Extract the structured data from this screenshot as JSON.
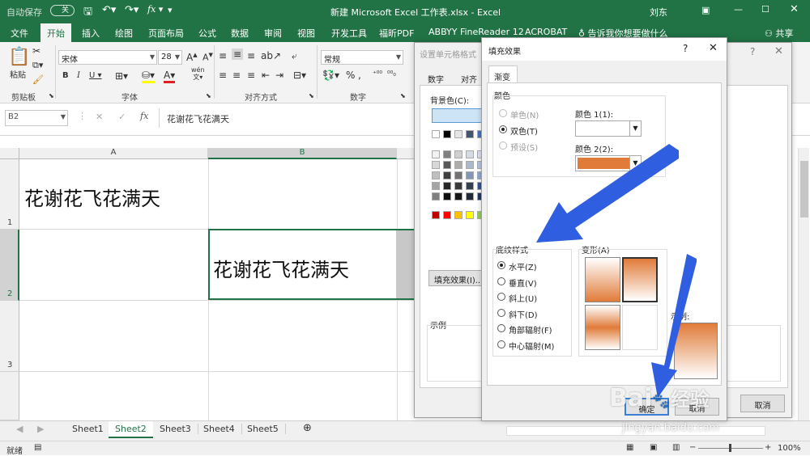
{
  "titlebar": {
    "autosave": "自动保存",
    "autosave_state": "关",
    "title": "新建 Microsoft Excel 工作表.xlsx  -  Excel",
    "user": "刘东"
  },
  "tabs": [
    "文件",
    "开始",
    "插入",
    "绘图",
    "页面布局",
    "公式",
    "数据",
    "审阅",
    "视图",
    "开发工具",
    "福昕PDF",
    "ABBYY FineReader 12",
    "ACROBAT"
  ],
  "tell_me": "告诉我你想要做什么",
  "share": "共享",
  "ribbon": {
    "paste": "粘贴",
    "font_name": "宋体",
    "font_size": "28",
    "number_format": "常规",
    "groups": {
      "clipboard": "剪贴板",
      "font": "字体",
      "align": "对齐方式",
      "number": "数字"
    },
    "wen_label": "wén"
  },
  "formula": {
    "name_box": "B2",
    "fx": "fx",
    "content": "花谢花飞花满天"
  },
  "grid": {
    "col_a": "A",
    "col_b": "B",
    "row1": "1",
    "row2": "2",
    "row3": "3",
    "a1": "花谢花飞花满天",
    "b2": "花谢花飞花满天"
  },
  "sheets": [
    "Sheet1",
    "Sheet2",
    "Sheet3",
    "Sheet4",
    "Sheet5"
  ],
  "status": {
    "ready": "就绪",
    "zoom": "100%"
  },
  "format_dialog": {
    "title": "设置单元格格式",
    "tabs": [
      "数字",
      "对齐"
    ],
    "bg_label": "背景色(C):",
    "no_color": "无",
    "fill_effects_btn": "填充效果(I)...",
    "sample": "示例",
    "cancel": "取消"
  },
  "fill_dialog": {
    "title": "填充效果",
    "help": "?",
    "tab": "渐变",
    "colors_group": "颜色",
    "one_color": "单色(N)",
    "two_color": "双色(T)",
    "preset": "预设(S)",
    "color1": "颜色 1(1):",
    "color2": "颜色 2(2):",
    "color2_value": "#e07b39",
    "shading_group": "底纹样式",
    "styles": [
      "水平(Z)",
      "垂直(V)",
      "斜上(U)",
      "斜下(D)",
      "角部辐射(F)",
      "中心辐射(M)"
    ],
    "variants_group": "变形(A)",
    "sample": "示例:",
    "ok": "确定",
    "cancel": "取消"
  },
  "watermark": {
    "brand": "Bai",
    "brand2": "经验",
    "url": "jingyan.baidu.com"
  },
  "colors": {
    "accent": "#217346",
    "arrow": "#2f5fe0",
    "gradient": "#e07b39"
  }
}
